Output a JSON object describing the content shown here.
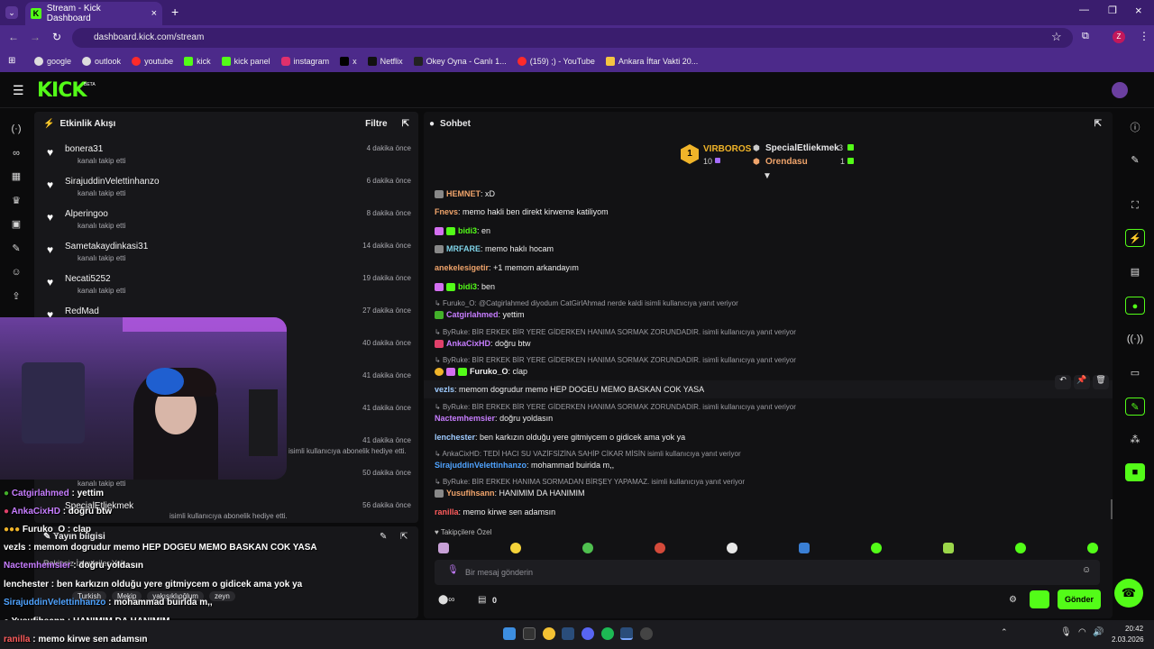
{
  "browser": {
    "tab_title": "Stream - Kick Dashboard",
    "url": "dashboard.kick.com/stream",
    "bookmarks": [
      "google",
      "outlook",
      "youtube",
      "kick",
      "kick panel",
      "instagram",
      "x",
      "Netflix",
      "Okey Oyna - Canlı 1...",
      "(159) ;) - YouTube",
      "Ankara İftar Vakti 20..."
    ]
  },
  "app": {
    "logo": "KICK",
    "logo_tag": "BETA"
  },
  "activity": {
    "title": "Etkinlik Akışı",
    "filter_label": "Filtre",
    "rows": [
      {
        "name": "bonera31",
        "sub": "kanalı takip etti",
        "time": "4 dakika önce"
      },
      {
        "name": "SirajuddinVelettinhanzo",
        "sub": "kanalı takip etti",
        "time": "6 dakika önce"
      },
      {
        "name": "Alperingoo",
        "sub": "kanalı takip etti",
        "time": "8 dakika önce"
      },
      {
        "name": "Sametakaydinkasi31",
        "sub": "kanalı takip etti",
        "time": "14 dakika önce"
      },
      {
        "name": "Necati5252",
        "sub": "kanalı takip etti",
        "time": "19 dakika önce"
      },
      {
        "name": "RedMad",
        "sub": "",
        "time": "27 dakika önce"
      },
      {
        "name": "",
        "sub": "",
        "time": "40 dakika önce"
      },
      {
        "name": "",
        "sub": "",
        "time": "41 dakika önce"
      },
      {
        "name": "",
        "sub": "",
        "time": "41 dakika önce"
      },
      {
        "name": "",
        "sub": "isimli kullanıcıya abonelik hediye etti.",
        "time": "41 dakika önce"
      },
      {
        "name": "",
        "sub": "kanalı takip etti",
        "time": "50 dakika önce"
      },
      {
        "name": "SpecialEtliekmek",
        "sub": "isimli kullanıcıya abonelik hediye etti.",
        "time": "56 dakika önce"
      }
    ]
  },
  "stream_info": {
    "title": "Yayın bilgisi",
    "line1": "Rakipsiz İzleyiciler Yok",
    "tags": [
      "Turkish",
      "Mekip",
      "yakışıklıoğlum",
      "zeyn"
    ]
  },
  "chat": {
    "title": "Sohbet",
    "leaderboard": {
      "rank1_name": "VIRBOROS",
      "rank1_count": "10",
      "rank2_name": "SpecialEtliekmek",
      "rank2_count": "3",
      "rank3_name": "Orendasu",
      "rank3_count": "1"
    },
    "messages": [
      {
        "reply": "",
        "user": "HEMNET",
        "color": "#f0a46b",
        "text": "xD"
      },
      {
        "reply": "",
        "user": "Fnevs",
        "color": "#f0a46b",
        "text": "memo hakli ben direkt kirweme katiliyom"
      },
      {
        "reply": "",
        "user": "bidi3",
        "color": "#53fc18",
        "text": "en"
      },
      {
        "reply": "",
        "user": "MRFARE",
        "color": "#7fd3e8",
        "text": "memo haklı hocam"
      },
      {
        "reply": "",
        "user": "anekelesigetir",
        "color": "#f0a46b",
        "text": "+1 memom arkandayım"
      },
      {
        "reply": "",
        "user": "bidi3",
        "color": "#53fc18",
        "text": "ben"
      },
      {
        "reply": "Furuko_O: @Catgirlahmed diyodum CatGirlAhmad nerde kaldi isimli kullanıcıya yanıt veriyor",
        "user": "Catgirlahmed",
        "color": "#c77dff",
        "text": "yettim"
      },
      {
        "reply": "ByRuke: BİR ERKEK BİR YERE GİDERKEN HANIMA SORMAK ZORUNDADIR. isimli kullanıcıya yanıt veriyor",
        "user": "AnkaCixHD",
        "color": "#c77dff",
        "text": "doğru btw"
      },
      {
        "reply": "ByRuke: BİR ERKEK BİR YERE GİDERKEN HANIMA SORMAK ZORUNDADIR. isimli kullanıcıya yanıt veriyor",
        "user": "Furuko_O",
        "color": "#f2f2f2",
        "text": "clap"
      },
      {
        "reply": "",
        "user": "vezls",
        "color": "#9ecbff",
        "text": "memom dogrudur memo HEP DOGEU MEMO BASKAN COK YASA"
      },
      {
        "reply": "ByRuke: BİR ERKEK BİR YERE GİDERKEN HANIMA SORMAK ZORUNDADIR. isimli kullanıcıya yanıt veriyor",
        "user": "Nactemhemsier",
        "color": "#c77dff",
        "text": "doğru yoldasın"
      },
      {
        "reply": "",
        "user": "lenchester",
        "color": "#9ecbff",
        "text": "ben karkızın olduğu yere gitmiycem o gidicek ama yok ya"
      },
      {
        "reply": "AnkaCixHD: TEDİ HACI SU VAZİFSİZİNA SAHİP CİKAR MİSİN isimli kullanıcıya yanıt veriyor",
        "user": "SirajuddinVelettinhanzo",
        "color": "#4fa3ff",
        "text": "mohammad buirida m,,"
      },
      {
        "reply": "ByRuke: BİR ERKEK HANIMA SORMADAN BİRŞEY YAPAMAZ. isimli kullanıcıya yanıt veriyor",
        "user": "Yusufihsann",
        "color": "#f0a46b",
        "text": "HANIMIM DA HANIMIM"
      },
      {
        "reply": "",
        "user": "ranilla",
        "color": "#ff5c5c",
        "text": "memo kirwe sen adamsın"
      }
    ],
    "followers_label": "Takipçilere Özel",
    "input_placeholder": "Bir mesaj gönderin",
    "points_count": "0",
    "send_label": "Gönder"
  },
  "overlay": [
    {
      "user": "Catgirlahmed",
      "color": "#c77dff",
      "text": " : yettim"
    },
    {
      "user": "AnkaCixHD",
      "color": "#c77dff",
      "text": " : doğru btw"
    },
    {
      "user": "Furuko_O",
      "color": "#ffffff",
      "text": " : clap"
    },
    {
      "user": "vezls",
      "color": "#ffffff",
      "text": " : memom dogrudur memo HEP DOGEU MEMO BASKAN COK YASA"
    },
    {
      "user": "Nactemhemsier",
      "color": "#c77dff",
      "text": " : doğru yoldasın"
    },
    {
      "user": "lenchester",
      "color": "#ffffff",
      "text": " : ben karkızın olduğu yere gitmiycem o gidicek ama yok ya"
    },
    {
      "user": "SirajuddinVelettinhanzo",
      "color": "#4fa3ff",
      "text": " : mohammad buirida m,,"
    },
    {
      "user": "Yusufihsann",
      "color": "#ffffff",
      "text": " : HANIMIM DA HANIMIM"
    },
    {
      "user": "ranilla",
      "color": "#ff5c5c",
      "text": " : memo kirwe sen adamsın"
    }
  ],
  "taskbar": {
    "time": "20:42",
    "date": "2.03.2026"
  },
  "colors": {
    "accent": "#53fc18",
    "chrome": "#4c2a8a"
  }
}
